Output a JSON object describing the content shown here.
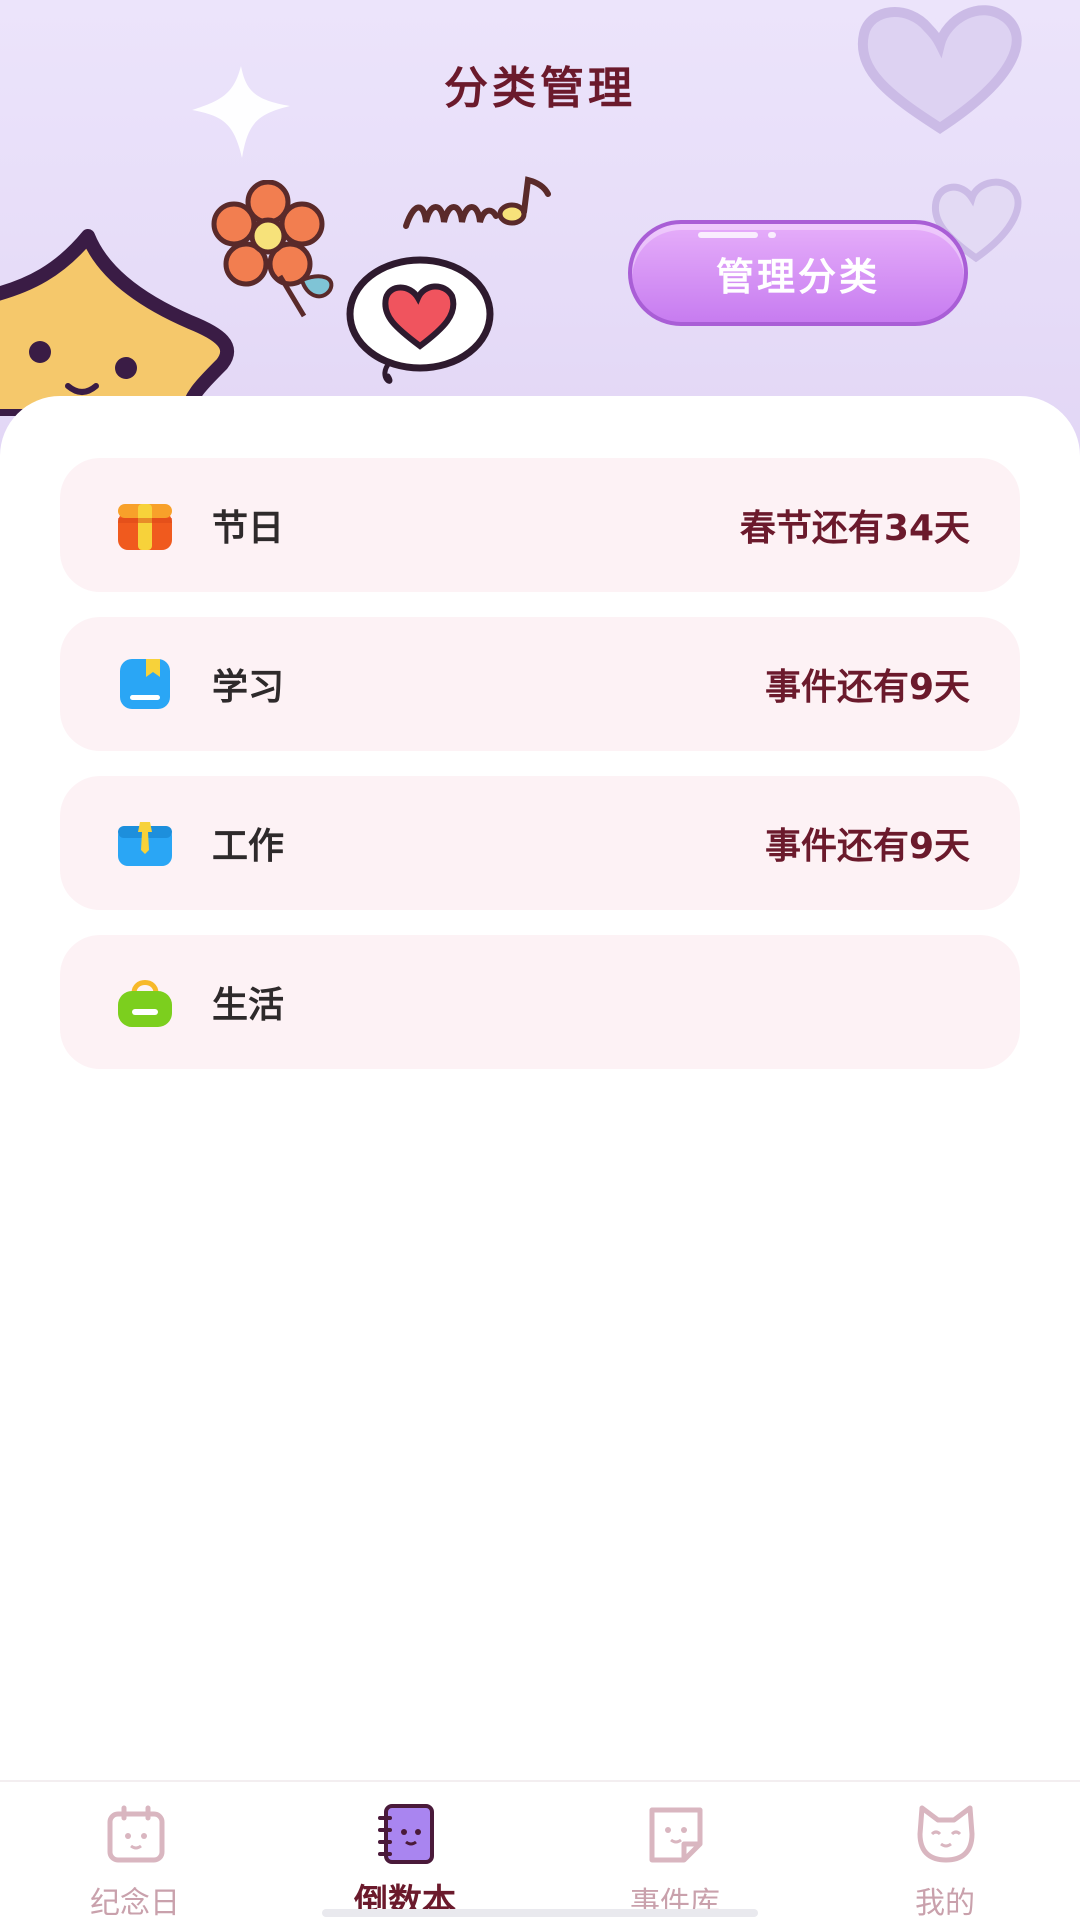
{
  "header": {
    "title": "分类管理",
    "manage_button": "管理分类"
  },
  "categories": [
    {
      "name": "节日",
      "info": "春节还有34天",
      "icon": "gift-icon",
      "color": "#f05a1e"
    },
    {
      "name": "学习",
      "info": "事件还有9天",
      "icon": "book-icon",
      "color": "#2aa6f5"
    },
    {
      "name": "工作",
      "info": "事件还有9天",
      "icon": "briefcase-icon",
      "color": "#2aa6f5"
    },
    {
      "name": "生活",
      "info": "",
      "icon": "bag-icon",
      "color": "#7ccf1e"
    }
  ],
  "tabbar": {
    "items": [
      {
        "label": "纪念日",
        "icon": "calendar-icon"
      },
      {
        "label": "倒数本",
        "icon": "notebook-icon",
        "active": true
      },
      {
        "label": "事件库",
        "icon": "note-icon"
      },
      {
        "label": "我的",
        "icon": "cat-icon"
      }
    ]
  },
  "colors": {
    "accent": "#6b1a2c",
    "button": "#c77cf0",
    "card": "#fdf2f5",
    "inactive_tab": "#c9a1ac"
  }
}
